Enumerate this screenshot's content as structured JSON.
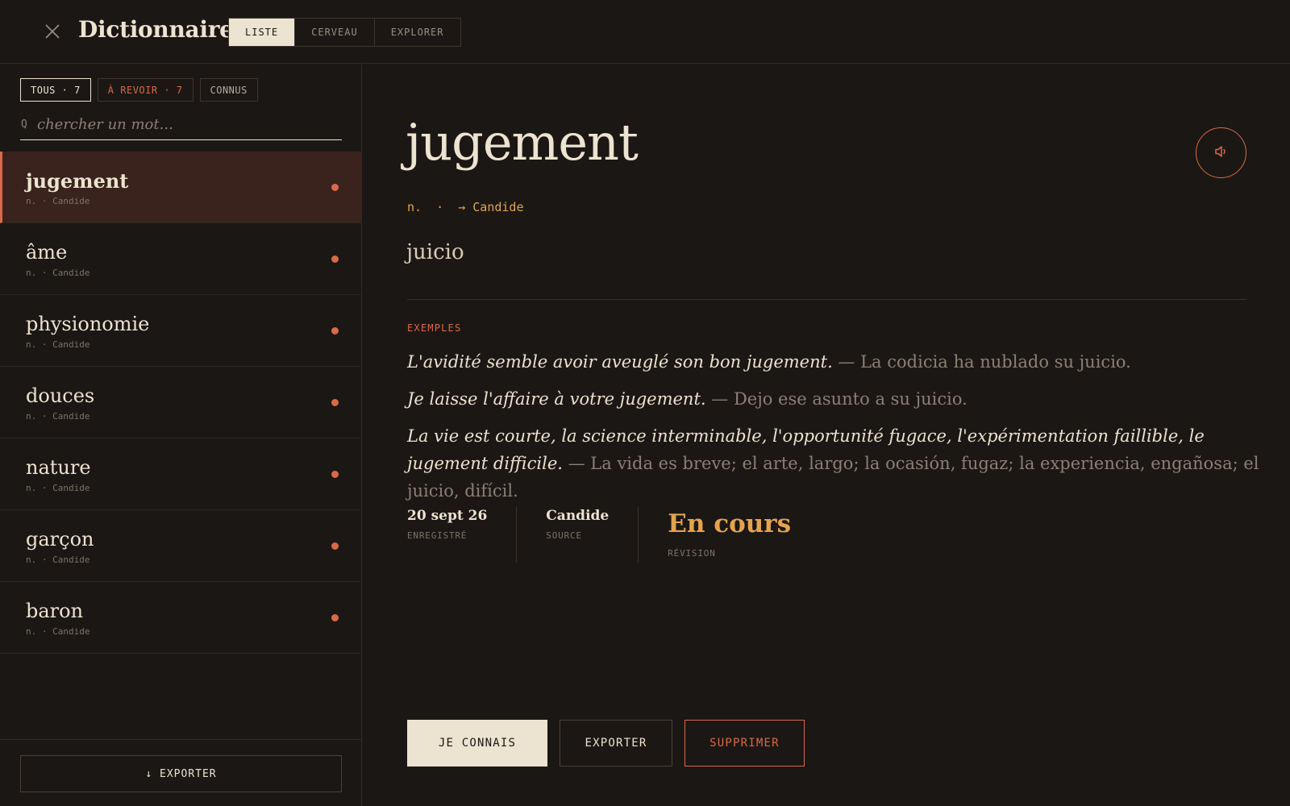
{
  "header": {
    "title": "Dictionnaire",
    "tabs": [
      {
        "label": "LISTE"
      },
      {
        "label": "CERVEAU"
      },
      {
        "label": "EXPLORER"
      }
    ]
  },
  "sidebar": {
    "filters": [
      {
        "label": "TOUS · 7"
      },
      {
        "label": "À REVOIR · 7"
      },
      {
        "label": "CONNUS"
      }
    ],
    "search": {
      "placeholder": "chercher un mot...",
      "icon_glyph": "Q"
    },
    "words": [
      {
        "word": "jugement",
        "meta": "n. · Candide"
      },
      {
        "word": "âme",
        "meta": "n. · Candide"
      },
      {
        "word": "physionomie",
        "meta": "n. · Candide"
      },
      {
        "word": "douces",
        "meta": "n. · Candide"
      },
      {
        "word": "nature",
        "meta": "n. · Candide"
      },
      {
        "word": "garçon",
        "meta": "n. · Candide"
      },
      {
        "word": "baron",
        "meta": "n. · Candide"
      }
    ],
    "export_label": "↓ EXPORTER"
  },
  "detail": {
    "headword": "jugement",
    "pos_line": "n.  ·  → Candide",
    "translation": "juicio",
    "examples_label": "EXEMPLES",
    "examples": [
      {
        "fr": "L'avidité semble avoir aveuglé son bon jugement.",
        "sep": " — ",
        "es": "La codicia ha nublado su juicio."
      },
      {
        "fr": "Je laisse l'affaire à votre jugement.",
        "sep": " — ",
        "es": "Dejo ese asunto a su juicio."
      },
      {
        "fr": "La vie est courte, la science interminable, l'opportunité fugace, l'expérimentation faillible, le jugement difficile.",
        "sep": " — ",
        "es": "La vida es breve; el arte, largo; la ocasión, fugaz; la experiencia, engañosa; el juicio, difícil."
      }
    ],
    "meta": [
      {
        "value": "20 sept 26",
        "key": "ENREGISTRÉ"
      },
      {
        "value": "Candide",
        "key": "SOURCE"
      },
      {
        "value": "En cours",
        "key": "RÉVISION"
      }
    ],
    "actions": {
      "know": "JE CONNAIS",
      "export": "EXPORTER",
      "delete": "SUPPRIMER"
    }
  },
  "colors": {
    "background": "#1b1714",
    "text": "#ece3d0",
    "accent_red": "#d9694a",
    "accent_gold": "#e4a34f"
  },
  "icons": {
    "close": "close-icon",
    "search": "search-icon",
    "audio": "speaker-icon",
    "status": "dot-indicator"
  }
}
